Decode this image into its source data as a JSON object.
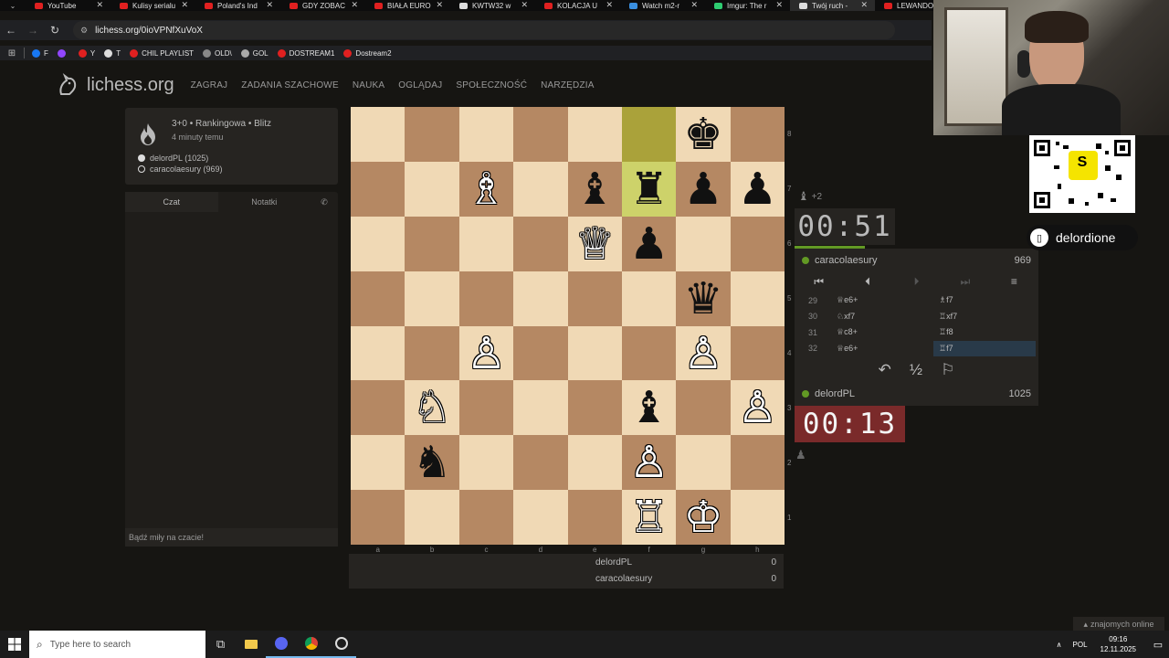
{
  "browser": {
    "tabs": [
      {
        "label": "YouTube",
        "color": "#e02020"
      },
      {
        "label": "Kulisy serialu",
        "color": "#e02020"
      },
      {
        "label": "Poland's Ind",
        "color": "#e02020"
      },
      {
        "label": "GDY ZOBAC",
        "color": "#e02020"
      },
      {
        "label": "BIAŁA EURO",
        "color": "#e02020"
      },
      {
        "label": "KWTW32 w",
        "color": "#dddddd"
      },
      {
        "label": "KOLACJA U",
        "color": "#e02020"
      },
      {
        "label": "Watch m2-r",
        "color": "#3a8fe0"
      },
      {
        "label": "Imgur: The r",
        "color": "#2ecc71"
      },
      {
        "label": "Twój ruch - ",
        "color": "#dddddd"
      },
      {
        "label": "LEWANDOW",
        "color": "#e02020"
      }
    ],
    "url": "lichess.org/0ioVPNfXuVoX",
    "bookmarks": [
      {
        "label": "F",
        "color": "#1877f2"
      },
      {
        "label": "",
        "color": "#9146ff"
      },
      {
        "label": "Y",
        "color": "#e02020"
      },
      {
        "label": "T",
        "color": "#dddddd"
      },
      {
        "label": "CHIL PLAYLIST",
        "color": "#e02020"
      },
      {
        "label": "OLD\\",
        "color": "#888888"
      },
      {
        "label": "GOL",
        "color": "#aaaaaa"
      },
      {
        "label": "DOSTREAM1",
        "color": "#e02020"
      },
      {
        "label": "Dostream2",
        "color": "#e02020"
      }
    ]
  },
  "site": {
    "logo": "lichess.org",
    "nav": [
      "ZAGRAJ",
      "ZADANIA SZACHOWE",
      "NAUKA",
      "OGLĄDAJ",
      "SPOŁECZNOŚĆ",
      "NARZĘDZIA"
    ]
  },
  "game_info": {
    "title": "3+0 • Rankingowa • Blitz",
    "time_ago": "4 minuty temu",
    "white": "delordPL (1025)",
    "black": "caracolaesury (969)"
  },
  "chat": {
    "tab_chat": "Czat",
    "tab_notes": "Notatki",
    "placeholder": "Bądź miły na czacie!"
  },
  "board": {
    "files": [
      "a",
      "b",
      "c",
      "d",
      "e",
      "f",
      "g",
      "h"
    ],
    "ranks": [
      "8",
      "7",
      "6",
      "5",
      "4",
      "3",
      "2",
      "1"
    ],
    "highlight": [
      "f8",
      "f7"
    ],
    "pieces": {
      "g8": "♚",
      "c7": "♗",
      "e7": "♝",
      "f7": "♜",
      "g7": "♟",
      "h7": "♟",
      "e6": "♕",
      "f6": "♟",
      "g5": "♛",
      "c4": "♙",
      "g4": "♙",
      "b3": "♘",
      "f3": "♝",
      "h3": "♙",
      "b2": "♞",
      "f2": "♙",
      "f1": "♖",
      "g1": "♔"
    },
    "white_pieces": [
      "c7",
      "e6",
      "c4",
      "g4",
      "b3",
      "h3",
      "f2",
      "f1",
      "g1"
    ]
  },
  "score": {
    "rows": [
      {
        "name": "delordPL",
        "score": "0"
      },
      {
        "name": "caracolaesury",
        "score": "0"
      }
    ]
  },
  "opponent": {
    "material": "+2",
    "clock": "00:51",
    "name": "caracolaesury",
    "rating": "969",
    "time_fraction": 0.29
  },
  "player": {
    "clock": "00:13",
    "name": "delordPL",
    "rating": "1025"
  },
  "moves": [
    {
      "n": "29",
      "w": "♕e6+",
      "b": "♗f7"
    },
    {
      "n": "30",
      "w": "♘xf7",
      "b": "♖xf7"
    },
    {
      "n": "31",
      "w": "♕c8+",
      "b": "♖f8"
    },
    {
      "n": "32",
      "w": "♕e6+",
      "b": "♖f7"
    }
  ],
  "move_controls": [
    "⏮",
    "⏴",
    "⏵",
    "⏭",
    "≡"
  ],
  "actions": [
    "↶",
    "½",
    "⚐"
  ],
  "stream": {
    "badge": "delordione",
    "qr_letter": "S"
  },
  "friends_online": "znajomych online",
  "taskbar": {
    "search_placeholder": "Type here to search",
    "lang": "POL",
    "time": "09:16",
    "date": "12.11.2025"
  }
}
